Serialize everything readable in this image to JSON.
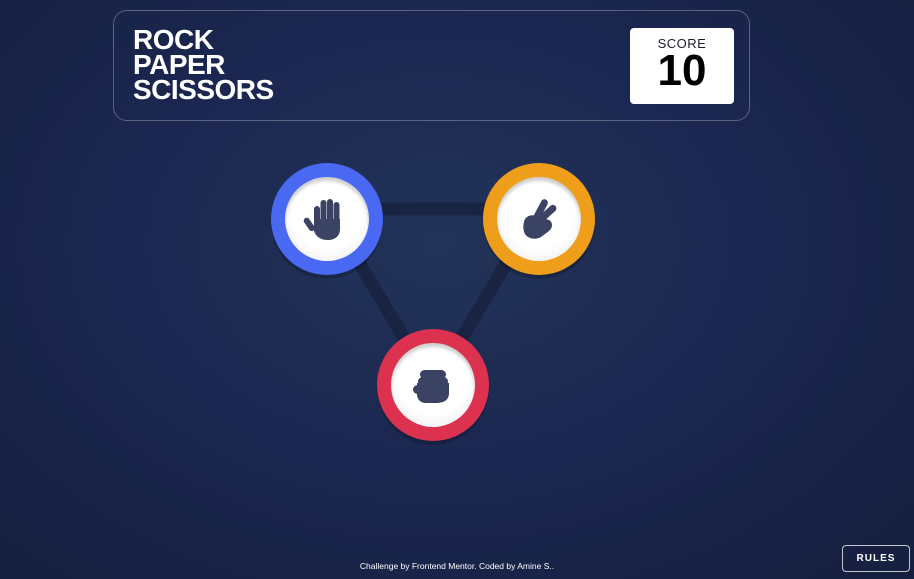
{
  "header": {
    "title_lines": [
      "ROCK",
      "PAPER",
      "SCISSORS"
    ],
    "score_label": "SCORE",
    "score_value": "10"
  },
  "choices": [
    {
      "name": "paper",
      "icon": "paper-hand-icon",
      "ring_color": "#4a69f2"
    },
    {
      "name": "scissors",
      "icon": "scissors-hand-icon",
      "ring_color": "#ee9e1a"
    },
    {
      "name": "rock",
      "icon": "rock-fist-icon",
      "ring_color": "#dd3150"
    }
  ],
  "colors": {
    "background": "#1b2751",
    "triangle_line": "#161f3a",
    "icon_fill": "#3a4363"
  },
  "footer": {
    "attribution": "Challenge by Frontend Mentor. Coded by Amine S.."
  },
  "rules_button": {
    "label": "RULES"
  }
}
